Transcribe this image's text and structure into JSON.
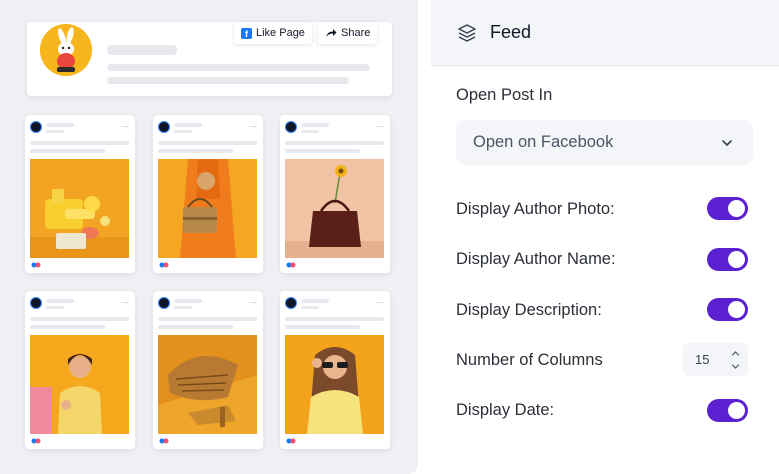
{
  "preview": {
    "like_page_label": "Like Page",
    "share_label": "Share",
    "card_more_glyph": "...",
    "post_images": [
      "yellow-product-still-life",
      "woman-straw-bag",
      "leather-handbag-flower",
      "woman-yellow-sweater",
      "woven-bag-and-sandals",
      "woman-yellow-sunglasses"
    ]
  },
  "panel": {
    "title": "Feed",
    "open_post_label": "Open Post In",
    "open_post_value": "Open on Facebook",
    "author_photo_label": "Display Author Photo:",
    "author_photo_on": true,
    "author_name_label": "Display Author Name:",
    "author_name_on": true,
    "description_label": "Display Description:",
    "description_on": true,
    "columns_label": "Number of Columns",
    "columns_value": "15",
    "date_label": "Display Date:",
    "date_on": true
  },
  "colors": {
    "toggle_on": "#5b21d1",
    "facebook_blue": "#1877f2",
    "panel_header_bg": "#f3f5f9",
    "preview_bg": "#eef0f4"
  }
}
